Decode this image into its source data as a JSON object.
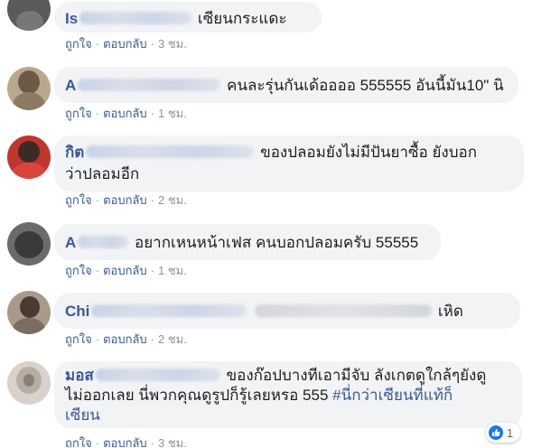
{
  "actions": {
    "like": "ถูกใจ",
    "reply": "ตอบกลับ",
    "separator": "·"
  },
  "comments": [
    {
      "name_visible": "Is",
      "text": "เซียนกระแดะ",
      "time": "3 ชม."
    },
    {
      "name_visible": "A",
      "text": "คนละรุ่นกันเด้ออออ 555555 อันนี้มัน10\" นิ",
      "time": "1 ชม."
    },
    {
      "name_visible": "กิต",
      "text_line1": "ของปลอมยังไม่มีปันยาซื้อ ยังบอก",
      "text_line2": "ว่าปลอมอีก",
      "time": "2 ชม."
    },
    {
      "name_visible": "A",
      "text": "อยากเหนหน้าเฟส คนบอกปลอมครับ 55555",
      "time": "1 ชม."
    },
    {
      "name_visible": "Chi",
      "text": "เหิด",
      "time": "2 ชม."
    },
    {
      "name_visible": "มอส",
      "text_line1": "ของก๊อปบางทีเอามีจับ ลังเกตดูใกล้ๆยังดู",
      "text_line2": "ไม่ออกเลย นี่พวกคุณดูรูปก็รู้เลยหรอ 555",
      "hashtag_a": "#นี่กว่าเซียนที่แท้ก็",
      "hashtag_b": "เซียน",
      "reaction_count": "1",
      "time": "3 ชม."
    }
  ],
  "colors": {
    "link": "#385898",
    "bubble": "#f2f3f5",
    "meta": "#606770",
    "like": "#1877f2"
  }
}
